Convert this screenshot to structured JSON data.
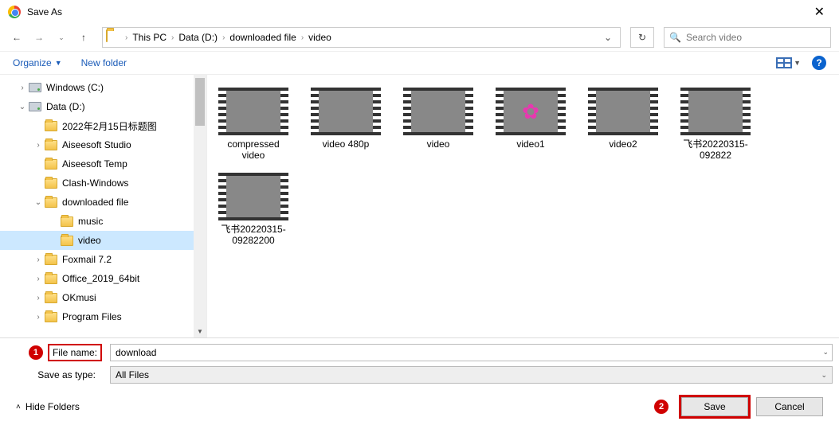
{
  "title": "Save As",
  "breadcrumbs": [
    "This PC",
    "Data (D:)",
    "downloaded file",
    "video"
  ],
  "search_placeholder": "Search video",
  "toolbar": {
    "organize": "Organize",
    "newfolder": "New folder"
  },
  "tree": [
    {
      "label": "Windows (C:)",
      "icon": "drive",
      "indent": 1,
      "chev": ">"
    },
    {
      "label": "Data (D:)",
      "icon": "drive",
      "indent": 1,
      "chev": "v"
    },
    {
      "label": "2022年2月15日标题图",
      "icon": "folder",
      "indent": 2,
      "chev": ""
    },
    {
      "label": "Aiseesoft Studio",
      "icon": "folder",
      "indent": 2,
      "chev": ">"
    },
    {
      "label": "Aiseesoft Temp",
      "icon": "folder",
      "indent": 2,
      "chev": ""
    },
    {
      "label": "Clash-Windows",
      "icon": "folder",
      "indent": 2,
      "chev": ""
    },
    {
      "label": "downloaded file",
      "icon": "folder",
      "indent": 2,
      "chev": "v"
    },
    {
      "label": "music",
      "icon": "folder",
      "indent": 3,
      "chev": ""
    },
    {
      "label": "video",
      "icon": "folder",
      "indent": 3,
      "chev": "",
      "selected": true
    },
    {
      "label": "Foxmail 7.2",
      "icon": "folder",
      "indent": 2,
      "chev": ">"
    },
    {
      "label": "Office_2019_64bit",
      "icon": "folder",
      "indent": 2,
      "chev": ">"
    },
    {
      "label": "OKmusi",
      "icon": "folder",
      "indent": 2,
      "chev": ">"
    },
    {
      "label": "Program Files",
      "icon": "folder",
      "indent": 2,
      "chev": ">"
    }
  ],
  "files": [
    {
      "label": "compressed video",
      "th": "th-a"
    },
    {
      "label": "video 480p",
      "th": "th-b"
    },
    {
      "label": "video",
      "th": "th-c"
    },
    {
      "label": "video1",
      "th": "th-d"
    },
    {
      "label": "video2",
      "th": "th-e"
    },
    {
      "label": "飞书20220315-092822",
      "th": "th-f"
    },
    {
      "label": "飞书20220315-09282200",
      "th": "th-g"
    }
  ],
  "filename_label": "File name:",
  "filename_value": "download",
  "savetype_label": "Save as type:",
  "savetype_value": "All Files",
  "hide_folders": "Hide Folders",
  "save_btn": "Save",
  "cancel_btn": "Cancel",
  "badge1": "1",
  "badge2": "2"
}
